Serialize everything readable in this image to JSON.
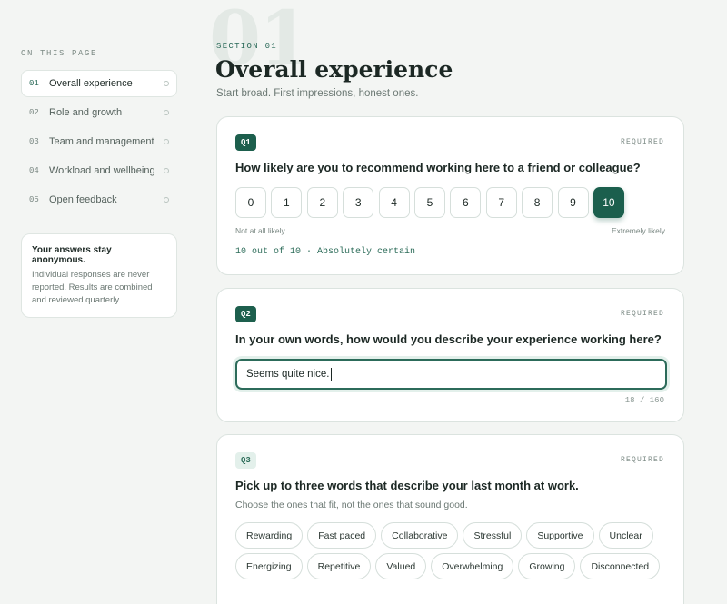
{
  "sidebar": {
    "heading": "ON THIS PAGE",
    "items": [
      {
        "num": "01",
        "label": "Overall experience",
        "active": true
      },
      {
        "num": "02",
        "label": "Role and growth"
      },
      {
        "num": "03",
        "label": "Team and management"
      },
      {
        "num": "04",
        "label": "Workload and wellbeing"
      },
      {
        "num": "05",
        "label": "Open feedback"
      }
    ],
    "anon_title": "Your answers stay anonymous.",
    "anon_body": "Individual responses are never reported. Results are combined and reviewed quarterly."
  },
  "section": {
    "bg_number": "01",
    "label": "SECTION 01",
    "title": "Overall experience",
    "subtitle": "Start broad. First impressions, honest ones."
  },
  "q1": {
    "badge": "Q1",
    "required": "REQUIRED",
    "text": "How likely are you to recommend working here to a friend or colleague?",
    "options": [
      "0",
      "1",
      "2",
      "3",
      "4",
      "5",
      "6",
      "7",
      "8",
      "9",
      "10"
    ],
    "selected": "10",
    "low_label": "Not at all likely",
    "high_label": "Extremely likely",
    "result": "10 out of 10 · Absolutely certain"
  },
  "q2": {
    "badge": "Q2",
    "required": "REQUIRED",
    "text": "In your own words, how would you describe your experience working here?",
    "value": "Seems quite nice.",
    "count": "18 / 160"
  },
  "q3": {
    "badge": "Q3",
    "required": "REQUIRED",
    "text": "Pick up to three words that describe your last month at work.",
    "subtext": "Choose the ones that fit, not the ones that sound good.",
    "chips": [
      "Rewarding",
      "Fast paced",
      "Collaborative",
      "Stressful",
      "Supportive",
      "Unclear",
      "Energizing",
      "Repetitive",
      "Valued",
      "Overwhelming",
      "Growing",
      "Disconnected"
    ]
  },
  "colors": {
    "accent": "#1b5f4d",
    "accent_light": "#e3f0eb",
    "background": "#f3f5f3"
  }
}
